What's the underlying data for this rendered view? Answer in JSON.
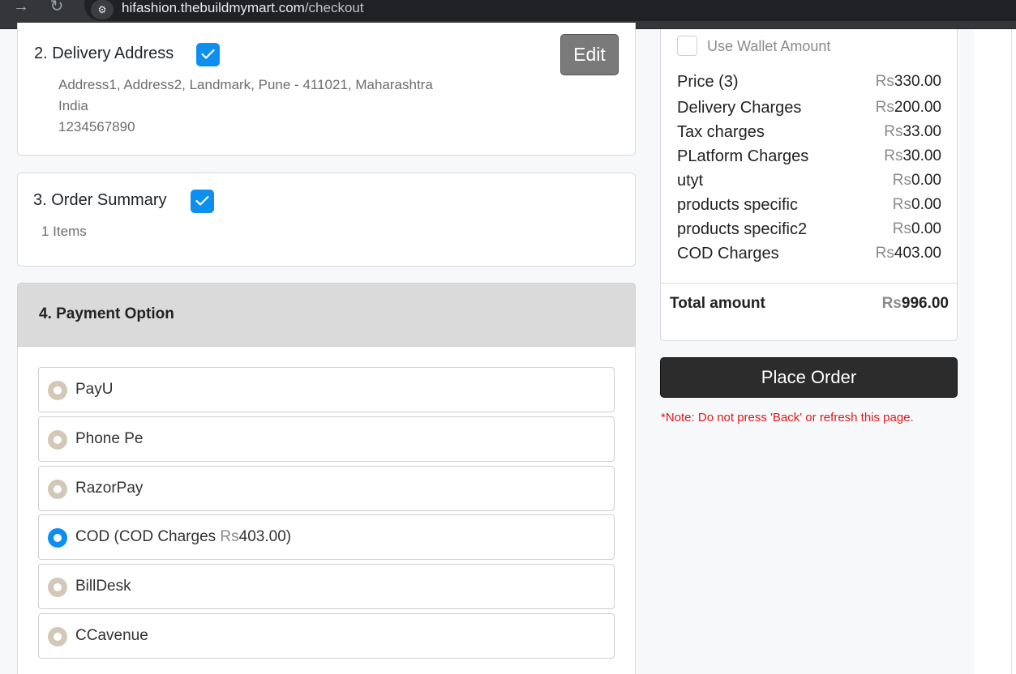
{
  "browser": {
    "url_host": "hifashion.thebuildmymart.com",
    "url_path": "/checkout"
  },
  "delivery": {
    "title": "2. Delivery Address",
    "edit_label": "Edit",
    "address_line1": "Address1, Address2, Landmark, Pune - 411021, Maharashtra",
    "country": "India",
    "phone": "1234567890"
  },
  "order_summary": {
    "title": "3. Order Summary",
    "items_text": "1 Items"
  },
  "payment": {
    "title": "4. Payment Option",
    "options": [
      {
        "label": "PayU",
        "selected": false
      },
      {
        "label": "Phone Pe",
        "selected": false
      },
      {
        "label": "RazorPay",
        "selected": false
      },
      {
        "label": "COD (COD Charges ",
        "currency": "Rs",
        "amount": "403.00",
        "suffix": ")",
        "selected": true
      },
      {
        "label": "BillDesk",
        "selected": false
      },
      {
        "label": "CCavenue",
        "selected": false
      }
    ]
  },
  "summary": {
    "wallet_label": "Use Wallet Amount",
    "currency": "Rs",
    "rows": [
      {
        "label": "Price (3)",
        "value": "330.00"
      },
      {
        "label": "Delivery Charges",
        "value": "200.00"
      },
      {
        "label": "Tax charges",
        "value": "33.00"
      },
      {
        "label": "PLatform Charges",
        "value": "30.00"
      },
      {
        "label": "utyt",
        "value": "0.00"
      },
      {
        "label": "products specific",
        "value": "0.00"
      },
      {
        "label": "products specific2",
        "value": "0.00"
      },
      {
        "label": "COD Charges",
        "value": "403.00"
      }
    ],
    "total_label": "Total amount",
    "total_value": "996.00"
  },
  "actions": {
    "place_order": "Place Order",
    "note": "*Note: Do not press 'Back' or refresh this page."
  },
  "colors": {
    "accent": "#0d8ff0",
    "note_red": "#e01919",
    "place_order_bg": "#2c2c2c"
  }
}
